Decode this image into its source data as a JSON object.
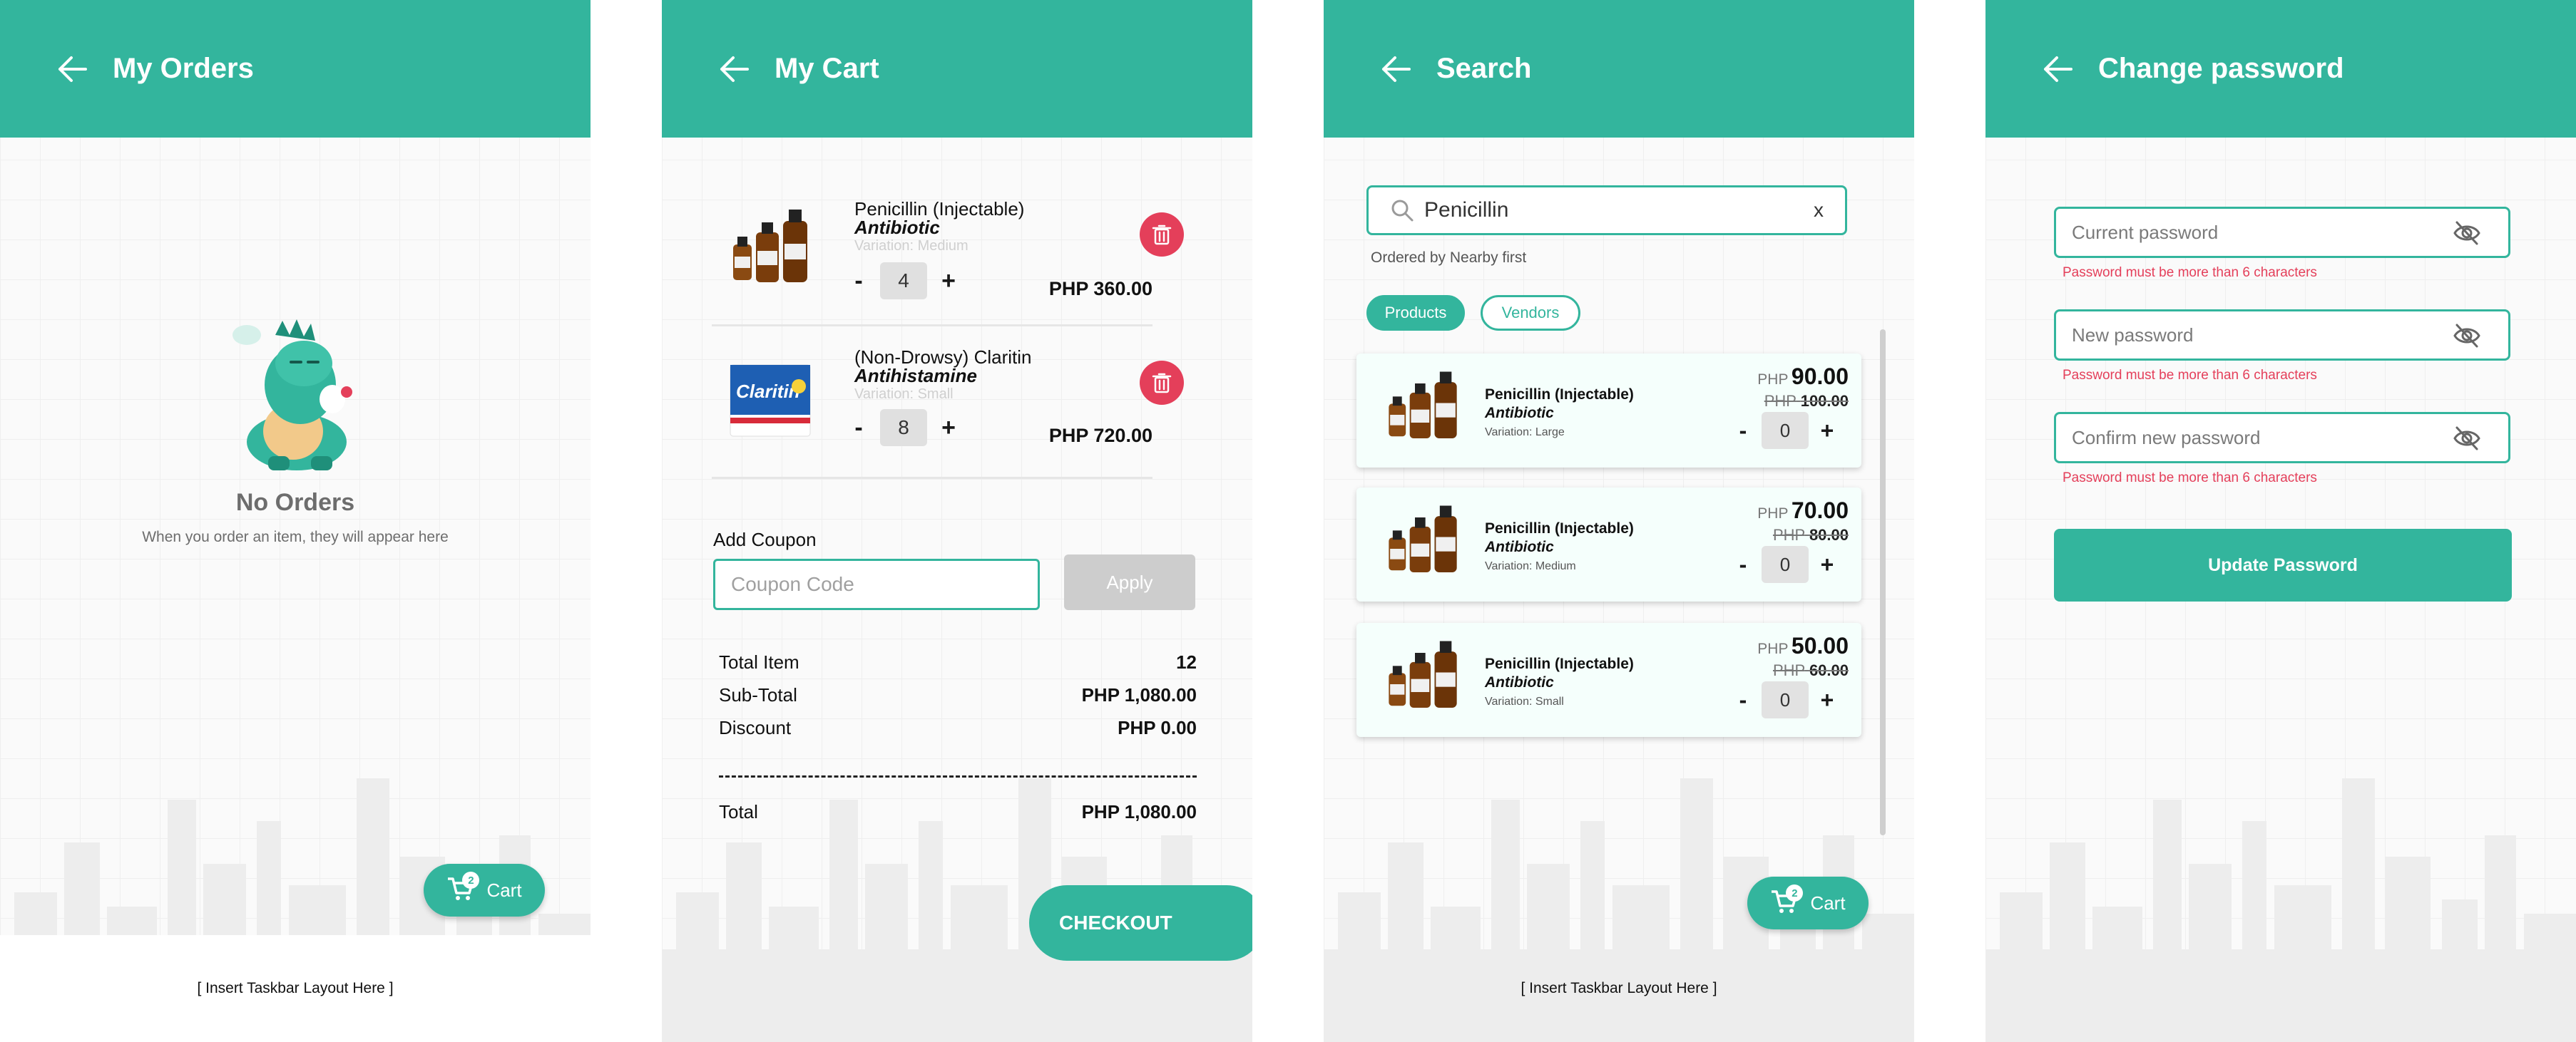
{
  "colors": {
    "accent": "#33b59d",
    "danger": "#e43f5a",
    "disabled": "#cdcdcd"
  },
  "orders": {
    "title": "My Orders",
    "empty_title": "No Orders",
    "empty_subtitle": "When you order an item, they will appear here",
    "cart_fab": {
      "label": "Cart",
      "badge": "2"
    },
    "taskbar": "[ Insert Taskbar Layout Here ]"
  },
  "cart": {
    "title": "My Cart",
    "items": [
      {
        "name": "Penicillin (Injectable)",
        "category": "Antibiotic",
        "variation": "Variation: Medium",
        "qty": "4",
        "price": "PHP 360.00"
      },
      {
        "name": "(Non-Drowsy) Claritin",
        "category": "Antihistamine",
        "variation": "Variation: Small",
        "qty": "8",
        "price": "PHP 720.00"
      }
    ],
    "coupon_label": "Add Coupon",
    "coupon_placeholder": "Coupon Code",
    "apply_label": "Apply",
    "summary": {
      "total_item_label": "Total Item",
      "total_item_value": "12",
      "subtotal_label": "Sub-Total",
      "subtotal_value": "PHP 1,080.00",
      "discount_label": "Discount",
      "discount_value": "PHP 0.00",
      "total_label": "Total",
      "total_value": "PHP 1,080.00"
    },
    "checkout_label": "CHECKOUT"
  },
  "search": {
    "title": "Search",
    "query": "Penicillin",
    "clear": "x",
    "ordered_by": "Ordered by Nearby first",
    "tabs": [
      "Products",
      "Vendors"
    ],
    "results": [
      {
        "name": "Penicillin (Injectable)",
        "category": "Antibiotic",
        "variation": "Variation: Large",
        "currency": "PHP",
        "price": "90.00",
        "old_currency": "PHP",
        "old_price": "100.00",
        "qty": "0"
      },
      {
        "name": "Penicillin (Injectable)",
        "category": "Antibiotic",
        "variation": "Variation: Medium",
        "currency": "PHP",
        "price": "70.00",
        "old_currency": "PHP",
        "old_price": "80.00",
        "qty": "0"
      },
      {
        "name": "Penicillin (Injectable)",
        "category": "Antibiotic",
        "variation": "Variation: Small",
        "currency": "PHP",
        "price": "50.00",
        "old_currency": "PHP",
        "old_price": "60.00",
        "qty": "0"
      }
    ],
    "cart_fab": {
      "label": "Cart",
      "badge": "2"
    },
    "taskbar": "[ Insert Taskbar Layout Here ]"
  },
  "password": {
    "title": "Change password",
    "fields": [
      {
        "placeholder": "Current password",
        "error": "Password must be more than 6 characters"
      },
      {
        "placeholder": "New password",
        "error": "Password must be more than 6 characters"
      },
      {
        "placeholder": "Confirm new password",
        "error": "Password must be more than 6 characters"
      }
    ],
    "update_label": "Update Password"
  },
  "icons": {
    "back": "arrow-left-icon",
    "trash": "trash-icon",
    "search": "search-icon",
    "eye": "eye-off-icon",
    "cart": "cart-icon"
  }
}
